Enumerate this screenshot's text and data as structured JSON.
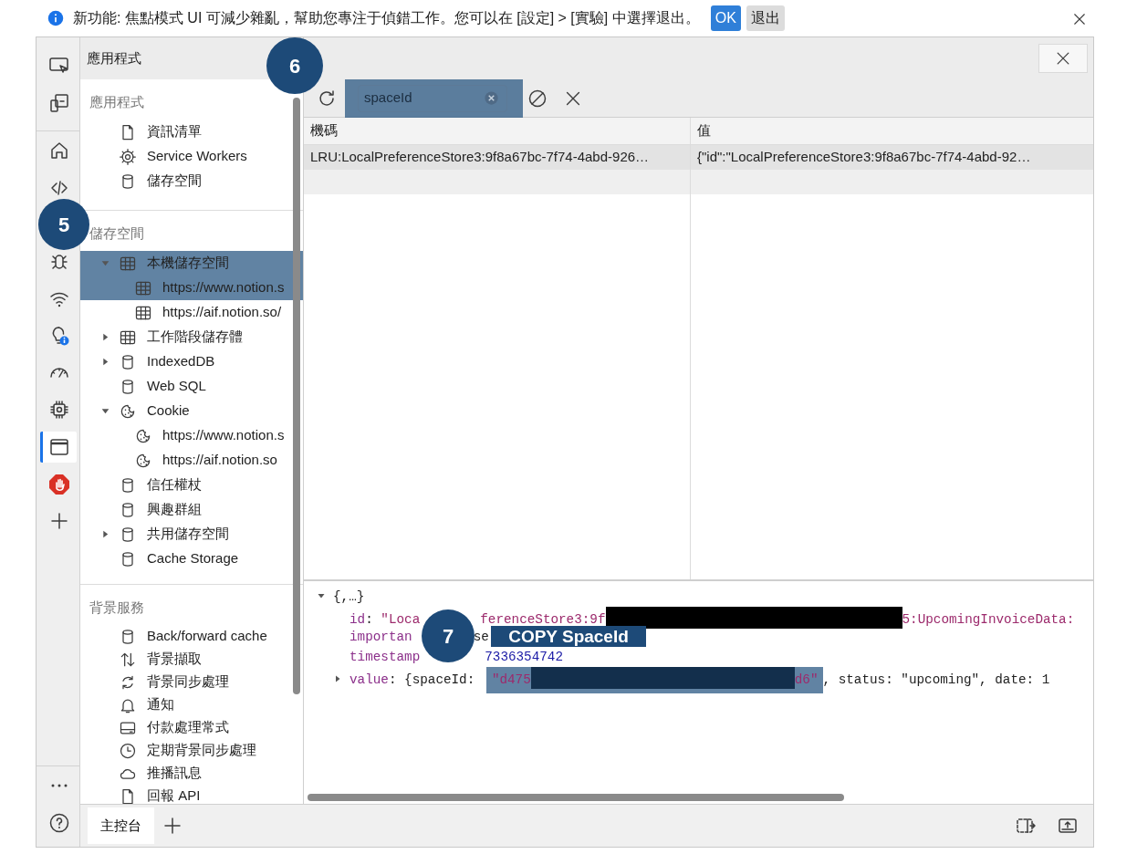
{
  "infobar": {
    "message": "新功能: 焦點模式 UI 可減少雜亂，幫助您專注于偵錯工作。您可以在 [設定] > [實驗] 中選擇退出。",
    "buttons": [
      {
        "label": "OK",
        "kind": "primary"
      },
      {
        "label": "退出",
        "kind": "secondary"
      }
    ]
  },
  "activity_bar": {
    "items": [
      {
        "kind": "screencast",
        "selected": false
      },
      {
        "kind": "device",
        "selected": false
      },
      {
        "kind": "welcome",
        "selected": false
      },
      {
        "kind": "elements",
        "selected": false
      },
      {
        "kind": "sources",
        "selected": false
      },
      {
        "kind": "network",
        "selected": false
      },
      {
        "kind": "issues",
        "selected": false
      },
      {
        "kind": "performance",
        "selected": false
      },
      {
        "kind": "memory",
        "selected": false
      },
      {
        "kind": "application",
        "selected": true
      },
      {
        "kind": "adblock",
        "selected": false
      },
      {
        "kind": "add",
        "selected": false
      }
    ],
    "footer": [
      {
        "kind": "more"
      },
      {
        "kind": "help"
      }
    ]
  },
  "sidebar": {
    "title": "應用程式",
    "sections": [
      {
        "title": "應用程式",
        "items": [
          {
            "label": "資訊清單",
            "kind": "manifest"
          },
          {
            "label": "Service Workers",
            "kind": "service-workers"
          },
          {
            "label": "儲存空間",
            "kind": "storage"
          }
        ]
      },
      {
        "title": "儲存空間",
        "items": [
          {
            "label": "本機儲存空間",
            "kind": "table",
            "expanded": true,
            "highlighted": true,
            "children": [
              {
                "label": "https://www.notion.s",
                "kind": "table",
                "highlighted": true
              },
              {
                "label": "https://aif.notion.so/",
                "kind": "table",
                "highlighted": false
              }
            ]
          },
          {
            "label": "工作階段儲存體",
            "kind": "table",
            "expanded": false,
            "highlighted": false
          },
          {
            "label": "IndexedDB",
            "kind": "database",
            "expanded": false,
            "highlighted": false
          },
          {
            "label": "Web SQL",
            "kind": "database",
            "highlighted": false
          },
          {
            "label": "Cookie",
            "kind": "cookie",
            "expanded": true,
            "highlighted": false,
            "children": [
              {
                "label": "https://www.notion.s",
                "kind": "cookie",
                "highlighted": false
              },
              {
                "label": "https://aif.notion.so",
                "kind": "cookie",
                "highlighted": false
              }
            ]
          },
          {
            "label": "信任權杖",
            "kind": "database",
            "highlighted": false
          },
          {
            "label": "興趣群組",
            "kind": "database",
            "highlighted": false
          },
          {
            "label": "共用儲存空間",
            "kind": "database",
            "expanded": false,
            "highlighted": false
          },
          {
            "label": "Cache Storage",
            "kind": "database",
            "highlighted": false
          }
        ]
      },
      {
        "title": "背景服務",
        "items": [
          {
            "label": "Back/forward cache",
            "kind": "database"
          },
          {
            "label": "背景擷取",
            "kind": "fetch"
          },
          {
            "label": "背景同步處理",
            "kind": "sync"
          },
          {
            "label": "通知",
            "kind": "notification"
          },
          {
            "label": "付款處理常式",
            "kind": "payment"
          },
          {
            "label": "定期背景同步處理",
            "kind": "periodic-sync"
          },
          {
            "label": "推播訊息",
            "kind": "push"
          },
          {
            "label": "回報 API",
            "kind": "reporting"
          }
        ]
      }
    ]
  },
  "toolbar": {
    "search": {
      "value": "spaceId",
      "highlighted": true
    }
  },
  "table": {
    "columns": [
      "機碼",
      "值"
    ],
    "rows": [
      {
        "cells": [
          "LRU:LocalPreferenceStore3:9f8a67bc-7f74-4abd-926…",
          "{\"id\":\"LocalPreferenceStore3:9f8a67bc-7f74-4abd-92…"
        ],
        "selected": true
      }
    ]
  },
  "preview": {
    "summary": "{,…}",
    "expanded": true,
    "lines": [
      {
        "pieces": [
          {
            "kind": "text",
            "tokens": [
              {
                "kind": "key",
                "text": "id"
              },
              {
                "kind": "punct",
                "text": ": "
              },
              {
                "kind": "string",
                "text": "\"Loca"
              }
            ]
          },
          {
            "kind": "covered"
          },
          {
            "kind": "text",
            "tokens": [
              {
                "kind": "string",
                "text": "ferenceStore3:9f"
              }
            ]
          },
          {
            "kind": "redacted"
          },
          {
            "kind": "text",
            "tokens": [
              {
                "kind": "string",
                "text": "5:UpcomingInvoiceData:"
              }
            ]
          }
        ]
      },
      {
        "pieces": [
          {
            "kind": "text",
            "tokens": [
              {
                "kind": "key",
                "text": "importan"
              }
            ]
          },
          {
            "kind": "covered"
          },
          {
            "kind": "text",
            "tokens": [
              {
                "kind": "punct",
                "text": "se"
              }
            ]
          }
        ]
      },
      {
        "pieces": [
          {
            "kind": "text",
            "tokens": [
              {
                "kind": "key",
                "text": "timestamp"
              }
            ]
          },
          {
            "kind": "covered"
          },
          {
            "kind": "text",
            "tokens": [
              {
                "kind": "number",
                "text": "7336354742"
              }
            ]
          }
        ]
      },
      {
        "expanded": false,
        "pieces": [
          {
            "kind": "text",
            "tokens": [
              {
                "kind": "key",
                "text": "value"
              },
              {
                "kind": "punct",
                "text": ": {spaceId: "
              }
            ]
          },
          {
            "kind": "highlight",
            "pieces": [
              {
                "kind": "text",
                "tokens": [
                  {
                    "kind": "string",
                    "text": "\"d475"
                  }
                ]
              },
              {
                "kind": "redacted"
              },
              {
                "kind": "text",
                "tokens": [
                  {
                    "kind": "string",
                    "text": "d6\""
                  }
                ]
              }
            ]
          },
          {
            "kind": "text",
            "tokens": [
              {
                "kind": "punct",
                "text": ", status: \"upcoming\", date: 1"
              }
            ]
          }
        ]
      }
    ]
  },
  "drawer": {
    "tabs": [
      {
        "label": "主控台",
        "selected": true
      }
    ]
  },
  "annotations": [
    {
      "number": "5"
    },
    {
      "number": "6"
    },
    {
      "number": "7",
      "label": "COPY SpaceId"
    }
  ]
}
